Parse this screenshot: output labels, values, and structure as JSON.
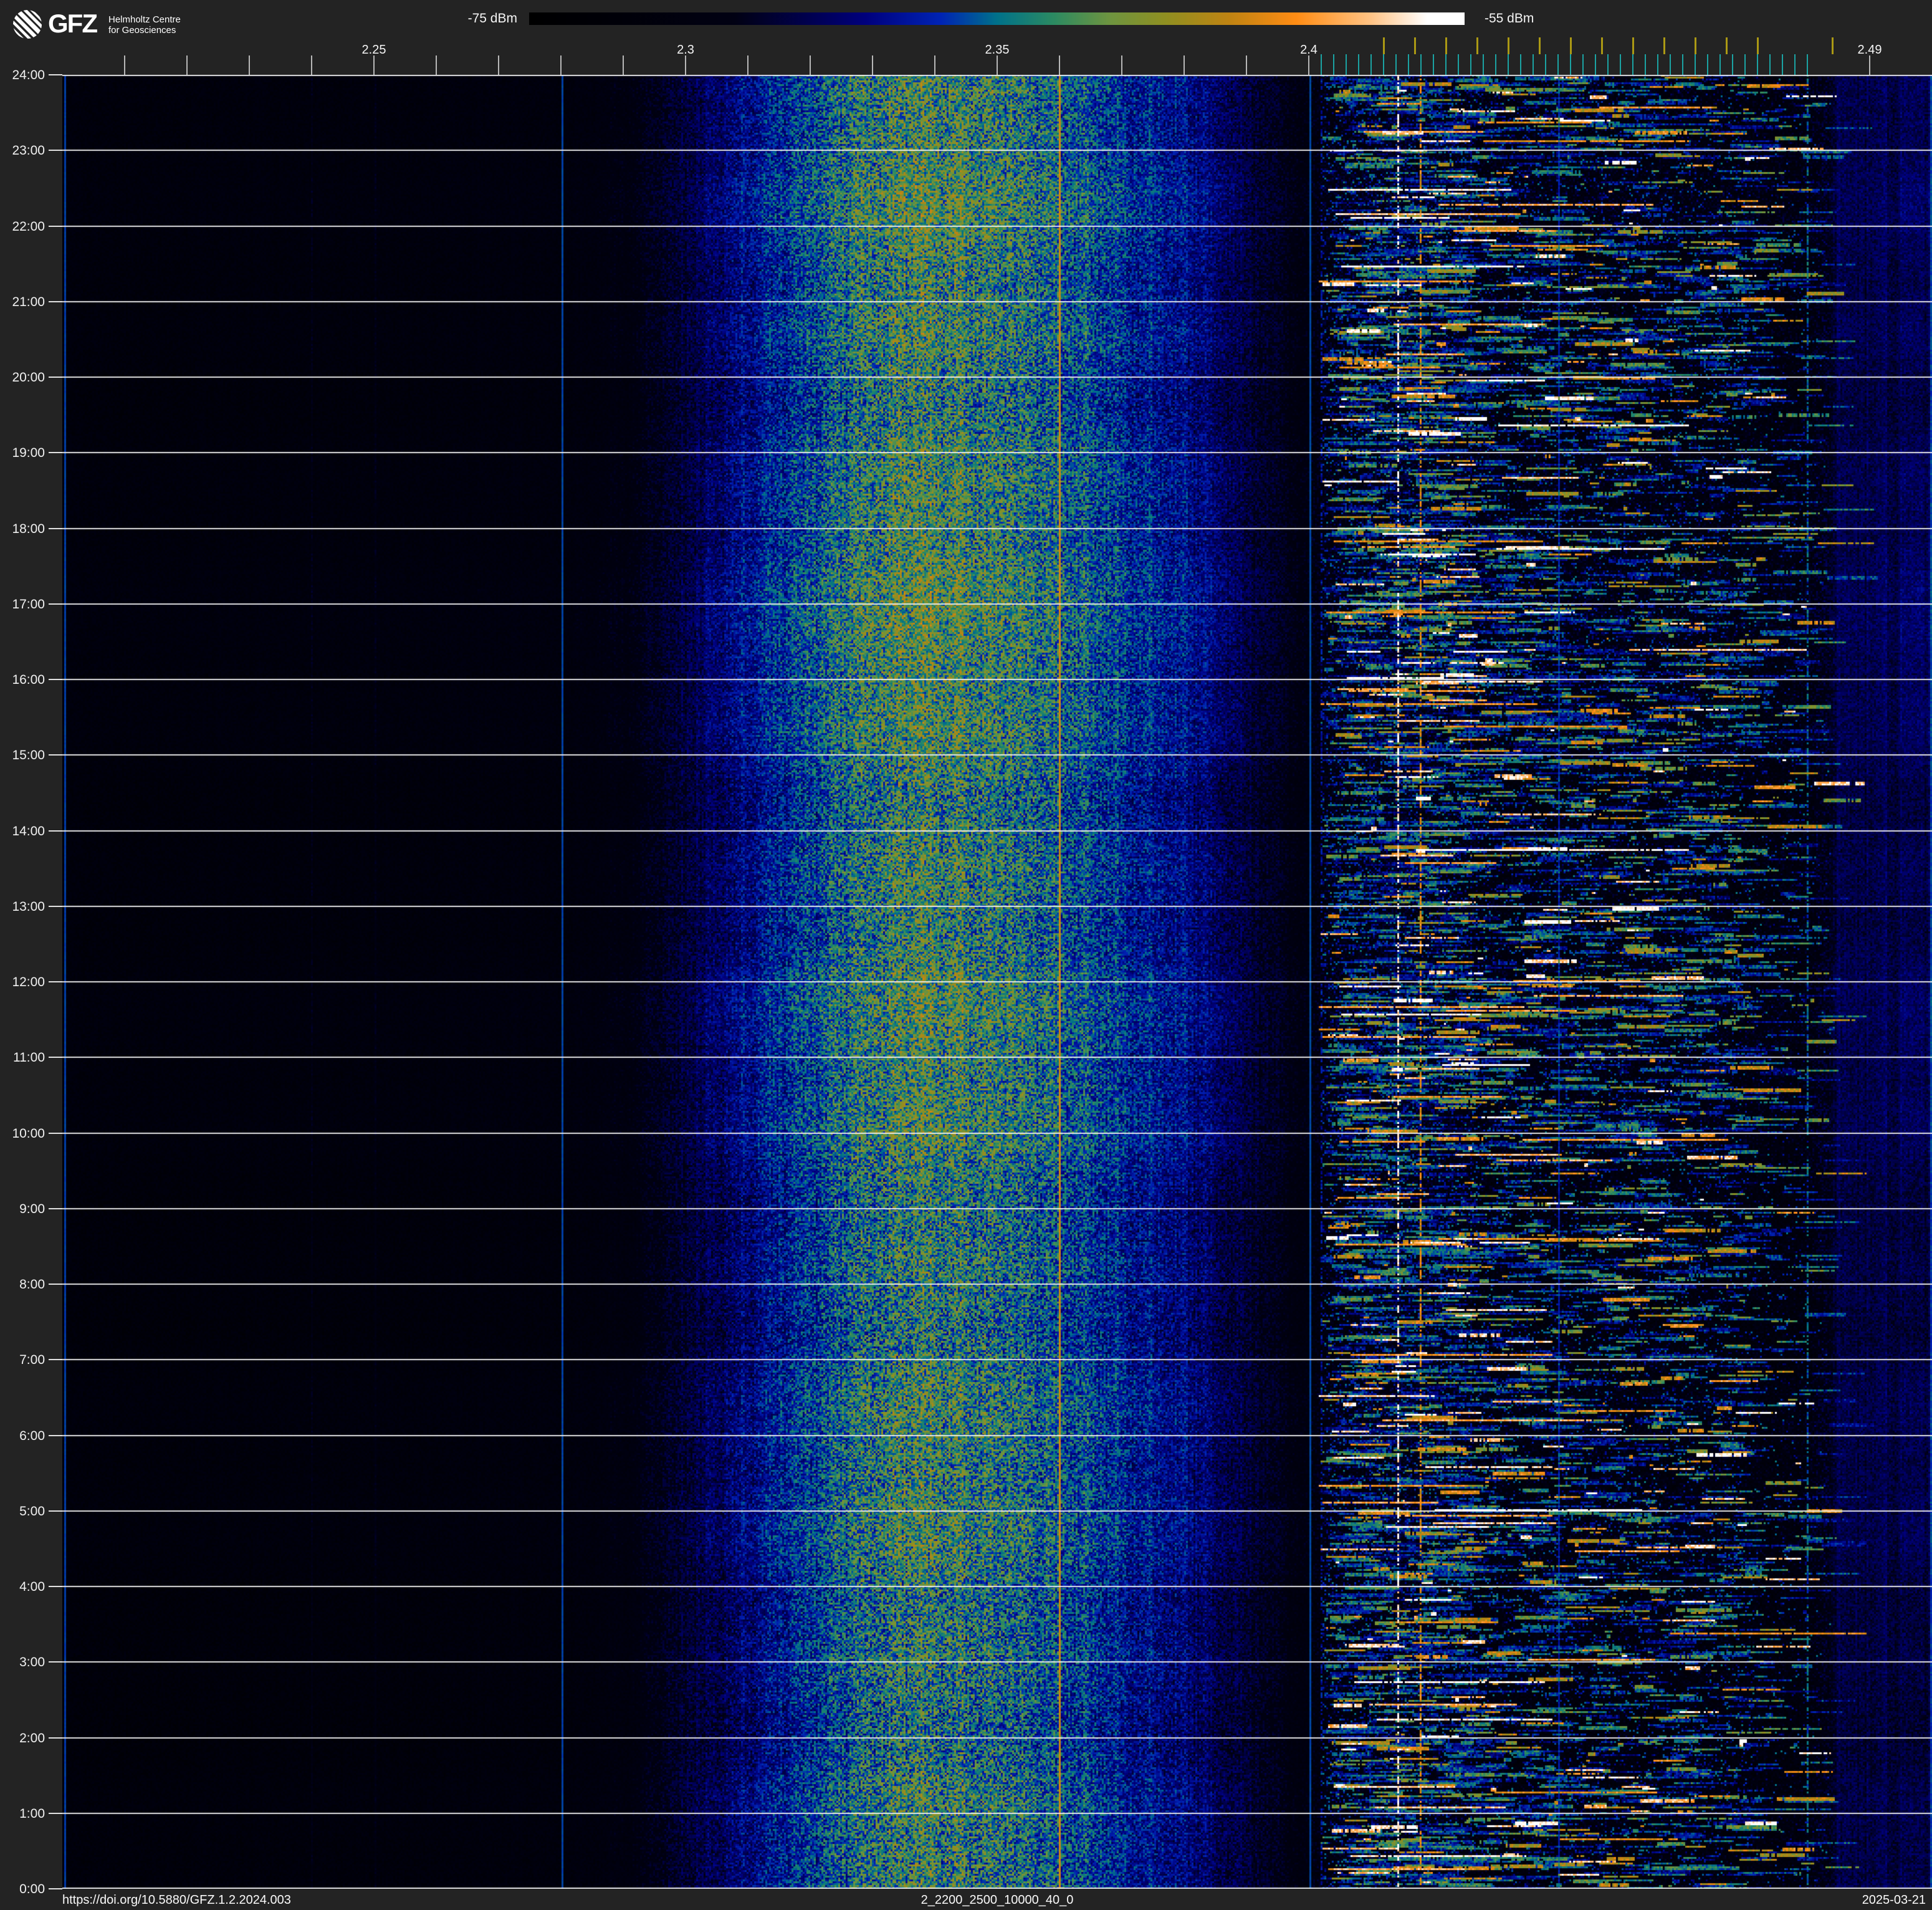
{
  "header": {
    "logo": {
      "text": "GFZ",
      "subtitle1": "Helmholtz Centre",
      "subtitle2": "for Geosciences"
    },
    "colorbar": {
      "min_label": "-75 dBm",
      "max_label": "-55 dBm"
    }
  },
  "freq_axis": {
    "labels": [
      {
        "text": "2.25",
        "f": 2.25
      },
      {
        "text": "2.3",
        "f": 2.3
      },
      {
        "text": "2.35",
        "f": 2.35
      },
      {
        "text": "2.4",
        "f": 2.4
      },
      {
        "text": "2.49",
        "f": 2.49
      }
    ],
    "major_ticks": {
      "start": 2.21,
      "end": 2.4,
      "step": 0.01,
      "extra": [
        2.49
      ],
      "color": "#b8b8b8"
    },
    "fine_ticks": {
      "start": 2.402,
      "end": 2.48,
      "step": 0.002,
      "color": "#1ba3a3"
    },
    "channel_ticks": {
      "freqs": [
        2.412,
        2.417,
        2.422,
        2.427,
        2.432,
        2.437,
        2.442,
        2.447,
        2.452,
        2.457,
        2.462,
        2.467,
        2.472,
        2.484
      ],
      "color": "#ab9914"
    }
  },
  "time_axis": {
    "labels": [
      "24:00",
      "23:00",
      "22:00",
      "21:00",
      "20:00",
      "19:00",
      "18:00",
      "17:00",
      "16:00",
      "15:00",
      "14:00",
      "13:00",
      "12:00",
      "11:00",
      "10:00",
      "9:00",
      "8:00",
      "7:00",
      "6:00",
      "5:00",
      "4:00",
      "3:00",
      "2:00",
      "1:00",
      "0:00"
    ]
  },
  "footer": {
    "doi": "https://doi.org/10.5880/GFZ.1.2.2024.003",
    "filename": "2_2200_2500_10000_40_0",
    "date": "2025-03-21"
  },
  "chart_data": {
    "type": "heatmap",
    "title": "2_2200_2500_10000_40_0",
    "description": "24-hour RF spectrogram (waterfall) of the 2.2-2.5 GHz band; broad emission band around 2.33 GHz and Wi-Fi channel activity between 2.401 and 2.484 GHz",
    "x_axis": {
      "unit": "GHz",
      "min": 2.2,
      "max": 2.5,
      "labeled_ticks": [
        2.25,
        2.3,
        2.35,
        2.4,
        2.49
      ]
    },
    "y_axis": {
      "unit": "time of day",
      "top": "24:00",
      "bottom": "0:00",
      "tick_step_hours": 1,
      "gridlines": true
    },
    "color_scale": {
      "min_dbm": -75,
      "max_dbm": -55,
      "stops": [
        [
          0.0,
          "#000000"
        ],
        [
          0.22,
          "#010113"
        ],
        [
          0.36,
          "#00007d"
        ],
        [
          0.44,
          "#0023b4"
        ],
        [
          0.5,
          "#00718a"
        ],
        [
          0.56,
          "#2b8a62"
        ],
        [
          0.62,
          "#6d9440"
        ],
        [
          0.68,
          "#8f8f21"
        ],
        [
          0.75,
          "#c08312"
        ],
        [
          0.82,
          "#ff8c14"
        ],
        [
          0.9,
          "#ffc385"
        ],
        [
          0.96,
          "#ffffff"
        ],
        [
          1.0,
          "#ffffff"
        ]
      ]
    },
    "background_profile": [
      [
        2.2,
        0.13
      ],
      [
        2.235,
        0.135
      ],
      [
        2.26,
        0.14
      ],
      [
        2.282,
        0.15
      ],
      [
        2.292,
        0.19
      ],
      [
        2.3,
        0.27
      ],
      [
        2.306,
        0.33
      ],
      [
        2.312,
        0.39
      ],
      [
        2.318,
        0.44
      ],
      [
        2.324,
        0.49
      ],
      [
        2.329,
        0.54
      ],
      [
        2.333,
        0.565
      ],
      [
        2.337,
        0.575
      ],
      [
        2.342,
        0.565
      ],
      [
        2.347,
        0.55
      ],
      [
        2.352,
        0.535
      ],
      [
        2.358,
        0.5
      ],
      [
        2.364,
        0.465
      ],
      [
        2.37,
        0.425
      ],
      [
        2.376,
        0.39
      ],
      [
        2.382,
        0.355
      ],
      [
        2.388,
        0.3
      ],
      [
        2.393,
        0.245
      ],
      [
        2.397,
        0.2
      ],
      [
        2.4005,
        0.17
      ],
      [
        2.41,
        0.19
      ],
      [
        2.414,
        0.21
      ],
      [
        2.418,
        0.19
      ],
      [
        2.43,
        0.17
      ],
      [
        2.47,
        0.165
      ],
      [
        2.48,
        0.17
      ],
      [
        2.4835,
        0.22
      ],
      [
        2.485,
        0.29
      ],
      [
        2.4945,
        0.3
      ],
      [
        2.5,
        0.3
      ]
    ],
    "markers": [
      {
        "f": 2.2003,
        "v": 0.52,
        "blend": 0.85,
        "note": "teal band-edge line"
      },
      {
        "f": 2.24,
        "v": 0.38,
        "blend": 0.3,
        "note": "faint blue line"
      },
      {
        "f": 2.25,
        "v": 0.38,
        "blend": 0.28,
        "note": "faint blue line"
      },
      {
        "f": 2.28,
        "v": 0.52,
        "blend": 0.85,
        "note": "teal marker line"
      },
      {
        "f": 2.36,
        "v": 0.8,
        "blend": 0.9,
        "note": "orange marker line"
      },
      {
        "f": 2.4,
        "v": 0.52,
        "blend": 0.85,
        "note": "teal marker line"
      },
      {
        "f": 2.44,
        "v": 0.5,
        "blend": 0.7,
        "note": "teal marker line"
      },
      {
        "f": 2.4947,
        "v": 0.34,
        "blend": 0.3,
        "note": "faint blue line"
      },
      {
        "f": 2.4997,
        "v": 0.62,
        "blend": 0.55,
        "note": "dark yellow right edge line"
      }
    ],
    "wifi_band": {
      "start": 2.4005,
      "end": 2.4835,
      "density_bands": [
        [
          2.402,
          2.425,
          1.0
        ],
        [
          2.425,
          2.447,
          0.62
        ],
        [
          2.447,
          2.47,
          0.55
        ],
        [
          2.47,
          2.48,
          0.25
        ],
        [
          2.48,
          2.4835,
          0.1
        ]
      ],
      "dotted_lines": [
        {
          "f": 2.4143,
          "v": 0.95,
          "density": 0.52,
          "note": "white dotted line"
        },
        {
          "f": 2.4178,
          "v": 0.78,
          "density": 0.6,
          "note": "orange dotted line"
        },
        {
          "f": 2.402,
          "v": 0.4,
          "density": 0.5,
          "note": "blue dotted line"
        },
        {
          "f": 2.4096,
          "v": 0.38,
          "density": 0.35,
          "note": "blue dotted line"
        },
        {
          "f": 2.426,
          "v": 0.38,
          "density": 0.3,
          "note": "blue dotted line"
        },
        {
          "f": 2.48,
          "v": 0.48,
          "density": 0.55,
          "note": "teal-blue dotted line"
        }
      ],
      "burst_count": 9500,
      "speckle_count": 26000,
      "streak_count": 95
    },
    "grid_color": "#f0f0f0"
  }
}
